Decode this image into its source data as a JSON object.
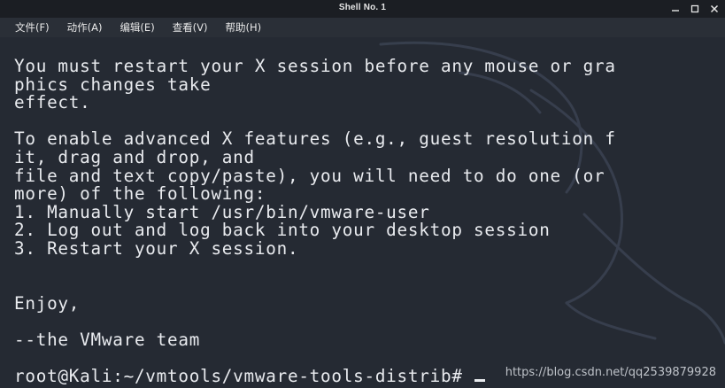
{
  "window": {
    "title": "Shell No. 1",
    "controls": {
      "minimize": "minimize-icon",
      "maximize": "maximize-icon",
      "close": "close-icon"
    }
  },
  "menu": {
    "items": [
      {
        "label": "文件(F)"
      },
      {
        "label": "动作(A)"
      },
      {
        "label": "编辑(E)"
      },
      {
        "label": "查看(V)"
      },
      {
        "label": "帮助(H)"
      }
    ]
  },
  "terminal": {
    "lines": [
      "You must restart your X session before any mouse or gra",
      "phics changes take",
      "effect.",
      "",
      "To enable advanced X features (e.g., guest resolution f",
      "it, drag and drop, and",
      "file and text copy/paste), you will need to do one (or",
      "more) of the following:",
      "1. Manually start /usr/bin/vmware-user",
      "2. Log out and log back into your desktop session",
      "3. Restart your X session.",
      "",
      "",
      "Enjoy,",
      "",
      "--the VMware team",
      "",
      "root@Kali:~/vmtools/vmware-tools-distrib# "
    ]
  },
  "watermark": "https://blog.csdn.net/qq2539879928",
  "colors": {
    "background": "#252a33",
    "text": "#e9ebef",
    "titlebar": "#1b1e23",
    "menubar": "#2a2f37"
  }
}
